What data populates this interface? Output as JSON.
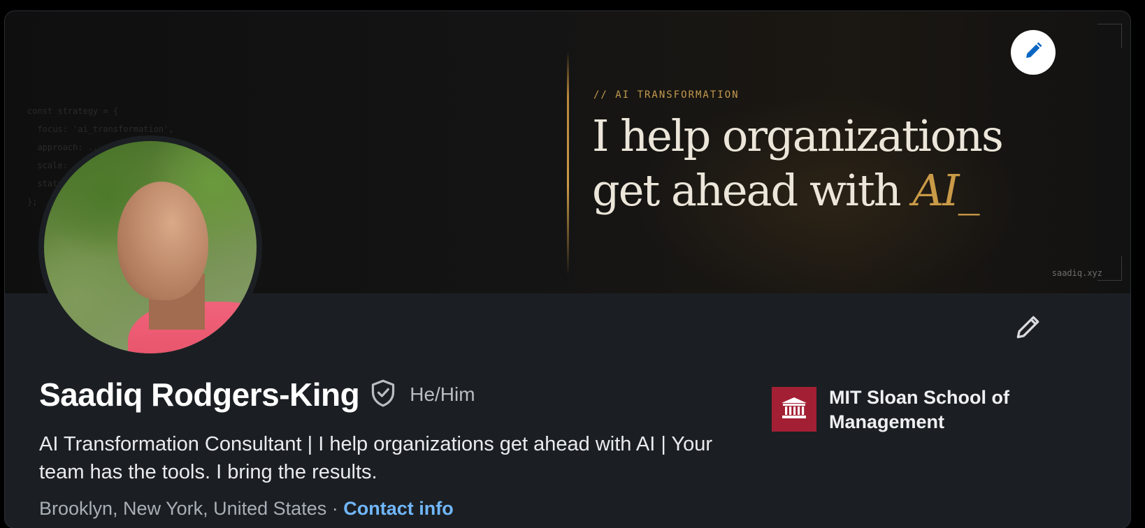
{
  "banner": {
    "eyebrow": "// AI TRANSFORMATION",
    "headline_line1": "I help organizations",
    "headline_line2_prefix": "get ahead with ",
    "headline_accent": "AI_",
    "site_tag": "saadiq.xyz",
    "code_snippet": "const strategy = {\n  focus: 'ai_transformation',\n  approach: ...\n  scale: ...\n  status: ...\n};",
    "accent_color": "#c99a47"
  },
  "profile": {
    "name": "Saadiq Rodgers-King",
    "pronouns": "He/Him",
    "headline": "AI Transformation Consultant | I help organizations get ahead with AI | Your team has the tools. I bring the results.",
    "location": "Brooklyn, New York, United States",
    "separator": "·",
    "contact_link": "Contact info"
  },
  "education": {
    "school_name": "MIT Sloan School of Management",
    "logo_color": "#a31f34"
  },
  "icons": {
    "edit_banner": "pencil-icon",
    "edit_profile": "pencil-icon",
    "verified": "shield-check-icon",
    "school": "building-columns-icon"
  }
}
